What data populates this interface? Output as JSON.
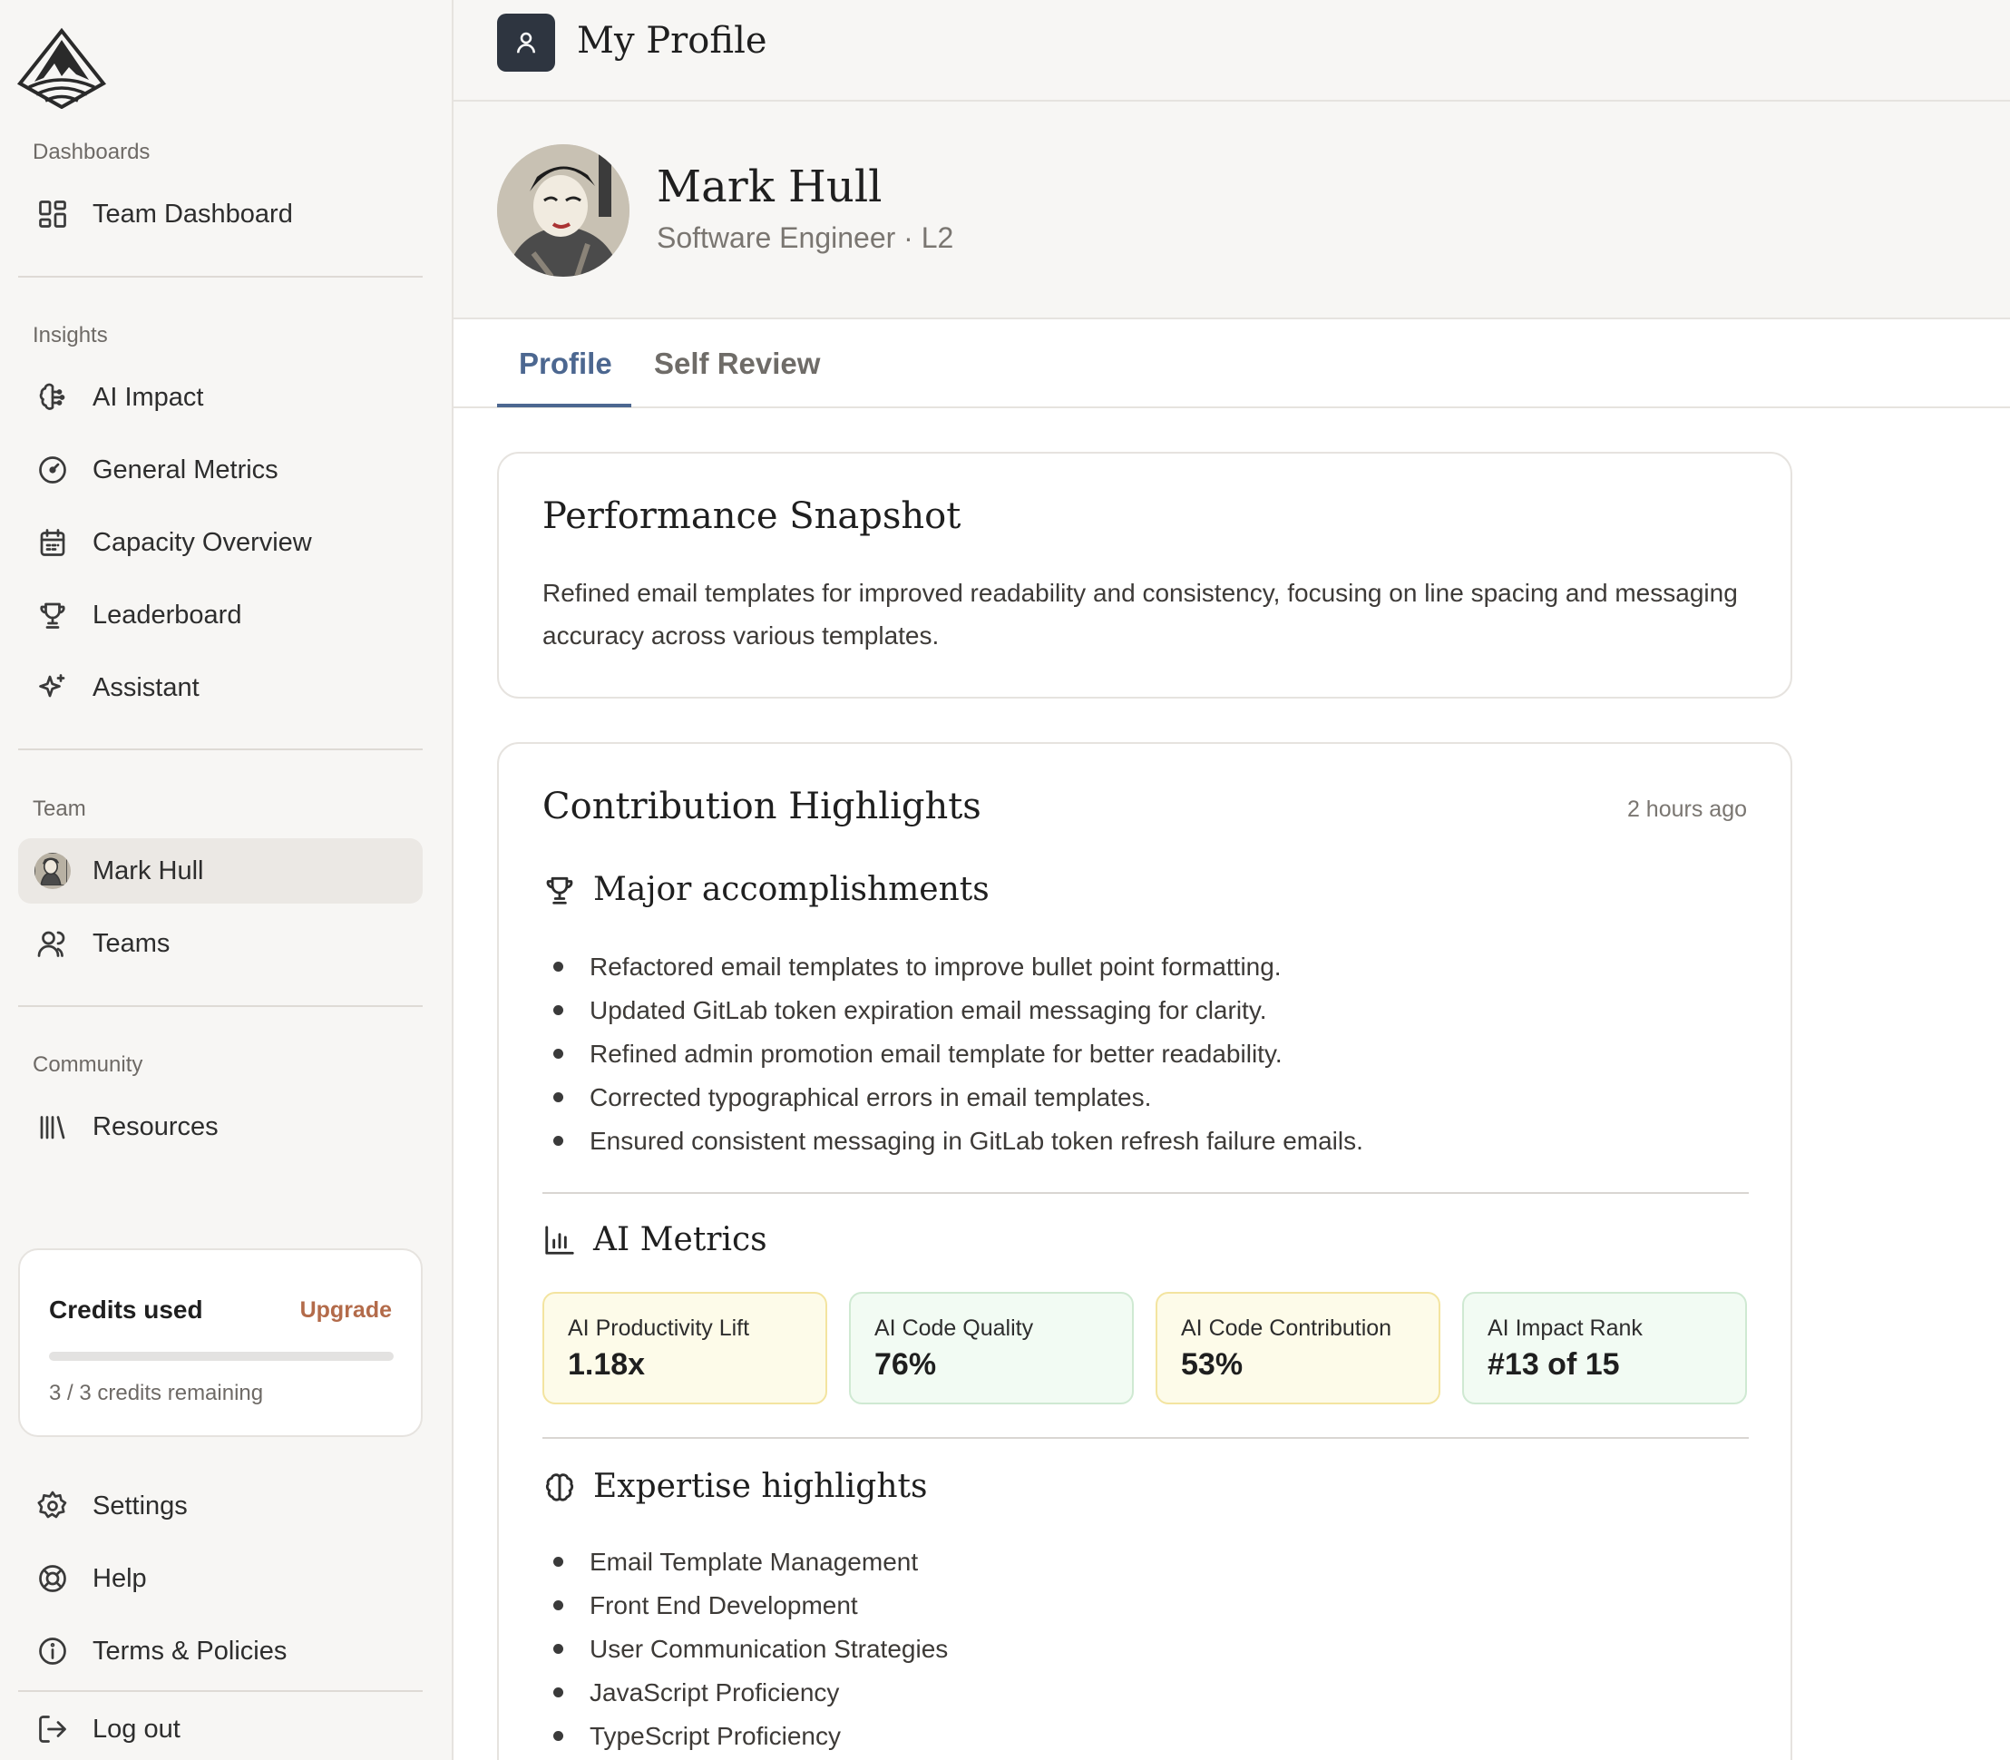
{
  "header": {
    "title": "My Profile"
  },
  "sidebar": {
    "sections": {
      "dashboards": "Dashboards",
      "insights": "Insights",
      "team": "Team",
      "community": "Community"
    },
    "items": {
      "team_dashboard": "Team Dashboard",
      "ai_impact": "AI Impact",
      "general_metrics": "General Metrics",
      "capacity_overview": "Capacity Overview",
      "leaderboard": "Leaderboard",
      "assistant": "Assistant",
      "mark_hull": "Mark Hull",
      "teams": "Teams",
      "resources": "Resources",
      "settings": "Settings",
      "help": "Help",
      "terms": "Terms & Policies",
      "logout": "Log out"
    },
    "credits": {
      "title": "Credits used",
      "upgrade": "Upgrade",
      "remaining": "3 / 3 credits remaining",
      "used_fraction": 0
    }
  },
  "profile": {
    "name": "Mark Hull",
    "role": "Software Engineer · L2"
  },
  "tabs": [
    {
      "label": "Profile",
      "active": true
    },
    {
      "label": "Self Review",
      "active": false
    }
  ],
  "snapshot": {
    "title": "Performance Snapshot",
    "text": "Refined email templates for improved readability and consistency, focusing on line spacing and messaging accuracy across various templates."
  },
  "contributions": {
    "title": "Contribution Highlights",
    "timestamp": "2 hours ago",
    "accomplishments_title": "Major accomplishments",
    "accomplishments": [
      "Refactored email templates to improve bullet point formatting.",
      "Updated GitLab token expiration email messaging for clarity.",
      "Refined admin promotion email template for better readability.",
      "Corrected typographical errors in email templates.",
      "Ensured consistent messaging in GitLab token refresh failure emails."
    ],
    "ai_metrics_title": "AI Metrics",
    "metrics": [
      {
        "label": "AI Productivity Lift",
        "value": "1.18x"
      },
      {
        "label": "AI Code Quality",
        "value": "76%"
      },
      {
        "label": "AI Code Contribution",
        "value": "53%"
      },
      {
        "label": "AI Impact Rank",
        "value": "#13 of 15"
      }
    ],
    "expertise_title": "Expertise highlights",
    "expertise": [
      "Email Template Management",
      "Front End Development",
      "User Communication Strategies",
      "JavaScript Proficiency",
      "TypeScript Proficiency"
    ]
  },
  "colors": {
    "accent": "#4c6790",
    "upgrade": "#b36b4a",
    "metric_yellow_bg": "#fdfbe9",
    "metric_green_bg": "#f2fbf3"
  }
}
